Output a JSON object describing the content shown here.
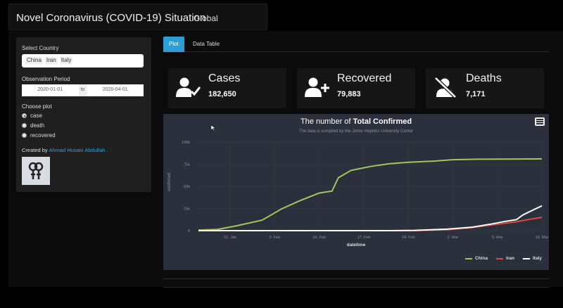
{
  "header": {
    "title": "Novel Coronavirus (COVID-19) Situation",
    "nav_global": "Global"
  },
  "sidebar": {
    "country_label": "Select Country",
    "countries": [
      "China",
      "Iran",
      "Italy"
    ],
    "period_label": "Observation Period",
    "date_start": "2020-01-01",
    "date_sep": "to",
    "date_end": "2020-04-01",
    "plot_label": "Choose plot",
    "plot_options": [
      "case",
      "death",
      "recovered"
    ],
    "selected_plot": "case",
    "credit_prefix": "Created by",
    "credit_name": "Ahmad Husain Abdullah ."
  },
  "tabs": [
    {
      "label": "Plot",
      "active": true
    },
    {
      "label": "Data Table",
      "active": false
    }
  ],
  "stats": [
    {
      "title": "Cases",
      "value": "182,650",
      "icon": "user-check-icon"
    },
    {
      "title": "Recovered",
      "value": "79,883",
      "icon": "user-plus-icon"
    },
    {
      "title": "Deaths",
      "value": "7,171",
      "icon": "user-slash-icon"
    }
  ],
  "chart": {
    "title_prefix": "The number of",
    "title_bold": "Total Confirmed",
    "subtitle": "The data is compiled by the Johns Hopkins University Center",
    "xlabel": "datetime",
    "ylabel": "confirmed"
  },
  "chart_data": {
    "type": "line",
    "title": "The number of Total Confirmed",
    "subtitle": "The data is compiled by the Johns Hopkins University Center",
    "xlabel": "datetime",
    "ylabel": "confirmed",
    "x_range": [
      "2020-01-22",
      "2020-03-16"
    ],
    "ylim": [
      0,
      100000
    ],
    "y_ticks": [
      "0",
      "25k",
      "50k",
      "75k",
      "100k"
    ],
    "x_ticks": [
      "21. Jan",
      "3. Feb",
      "10. Feb",
      "17. Feb",
      "24. Feb",
      "2. Mar",
      "9. Mar",
      "16. Mar"
    ],
    "legend_position": "bottom-right",
    "grid": true,
    "series": [
      {
        "name": "China",
        "color": "#a0c85a",
        "points": [
          [
            "2020-01-22",
            548
          ],
          [
            "2020-01-25",
            1400
          ],
          [
            "2020-01-28",
            5500
          ],
          [
            "2020-02-01",
            11800
          ],
          [
            "2020-02-04",
            24300
          ],
          [
            "2020-02-07",
            34000
          ],
          [
            "2020-02-10",
            42500
          ],
          [
            "2020-02-12",
            44700
          ],
          [
            "2020-02-13",
            59800
          ],
          [
            "2020-02-15",
            68000
          ],
          [
            "2020-02-18",
            72400
          ],
          [
            "2020-02-21",
            75500
          ],
          [
            "2020-02-24",
            77200
          ],
          [
            "2020-02-28",
            78500
          ],
          [
            "2020-03-02",
            80100
          ],
          [
            "2020-03-06",
            80600
          ],
          [
            "2020-03-10",
            80800
          ],
          [
            "2020-03-16",
            81000
          ]
        ]
      },
      {
        "name": "Iran",
        "color": "#e04a3a",
        "points": [
          [
            "2020-01-22",
            0
          ],
          [
            "2020-02-19",
            2
          ],
          [
            "2020-02-25",
            95
          ],
          [
            "2020-03-01",
            978
          ],
          [
            "2020-03-05",
            3500
          ],
          [
            "2020-03-09",
            7200
          ],
          [
            "2020-03-12",
            10000
          ],
          [
            "2020-03-14",
            12700
          ],
          [
            "2020-03-16",
            14991
          ]
        ]
      },
      {
        "name": "Italy",
        "color": "#ffffff",
        "points": [
          [
            "2020-01-22",
            0
          ],
          [
            "2020-02-21",
            20
          ],
          [
            "2020-02-25",
            322
          ],
          [
            "2020-03-01",
            1694
          ],
          [
            "2020-03-05",
            3858
          ],
          [
            "2020-03-08",
            7375
          ],
          [
            "2020-03-10",
            10149
          ],
          [
            "2020-03-12",
            12462
          ],
          [
            "2020-03-13",
            17660
          ],
          [
            "2020-03-14",
            21157
          ],
          [
            "2020-03-16",
            27980
          ]
        ]
      }
    ]
  }
}
